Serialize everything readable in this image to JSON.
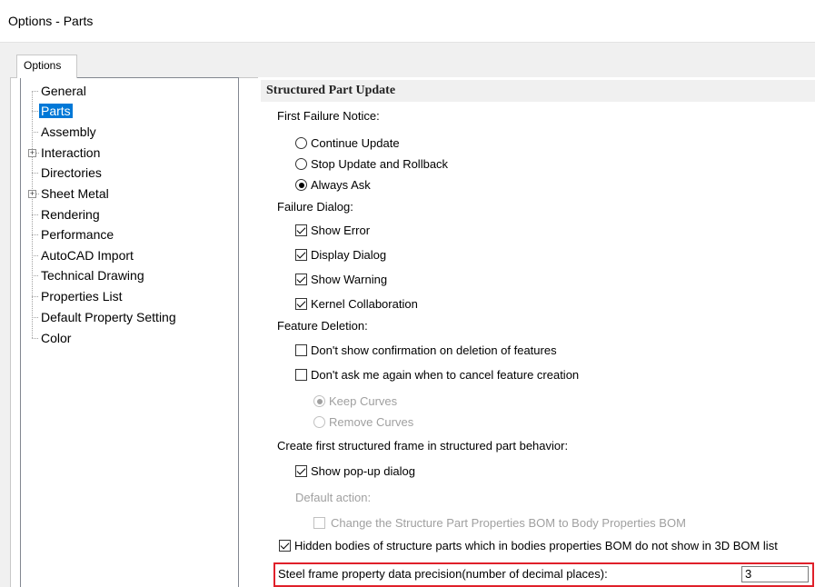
{
  "window": {
    "title": "Options - Parts"
  },
  "tabs": [
    {
      "label": "Options",
      "active": true
    }
  ],
  "tree": {
    "items": [
      {
        "label": "General",
        "selected": false,
        "expandable": false
      },
      {
        "label": "Parts",
        "selected": true,
        "expandable": false
      },
      {
        "label": "Assembly",
        "selected": false,
        "expandable": false
      },
      {
        "label": "Interaction",
        "selected": false,
        "expandable": true
      },
      {
        "label": "Directories",
        "selected": false,
        "expandable": false
      },
      {
        "label": "Sheet Metal",
        "selected": false,
        "expandable": true
      },
      {
        "label": "Rendering",
        "selected": false,
        "expandable": false
      },
      {
        "label": "Performance",
        "selected": false,
        "expandable": false
      },
      {
        "label": "AutoCAD Import",
        "selected": false,
        "expandable": false
      },
      {
        "label": "Technical Drawing",
        "selected": false,
        "expandable": false
      },
      {
        "label": "Properties List",
        "selected": false,
        "expandable": false
      },
      {
        "label": "Default Property Setting",
        "selected": false,
        "expandable": false
      },
      {
        "label": "Color",
        "selected": false,
        "expandable": false
      }
    ],
    "expander_symbol": "+"
  },
  "panel": {
    "section_title": "Structured Part Update",
    "first_failure_notice": {
      "label": "First Failure Notice:",
      "options": [
        {
          "label": "Continue Update",
          "checked": false
        },
        {
          "label": "Stop Update and Rollback",
          "checked": false
        },
        {
          "label": "Always Ask",
          "checked": true
        }
      ]
    },
    "failure_dialog": {
      "label": "Failure Dialog:",
      "options": [
        {
          "label": "Show Error",
          "checked": true
        },
        {
          "label": "Display Dialog",
          "checked": true
        },
        {
          "label": "Show Warning",
          "checked": true
        },
        {
          "label": "Kernel Collaboration",
          "checked": true
        }
      ]
    },
    "feature_deletion": {
      "label": "Feature Deletion:",
      "options": [
        {
          "label": "Don't show confirmation on deletion of features",
          "checked": false
        },
        {
          "label": "Don't ask me again when to cancel feature creation",
          "checked": false
        }
      ],
      "curve_options": [
        {
          "label": "Keep Curves",
          "checked": true,
          "enabled": false
        },
        {
          "label": "Remove Curves",
          "checked": false,
          "enabled": false
        }
      ]
    },
    "first_frame": {
      "label": "Create first structured frame in structured part behavior:",
      "show_popup": {
        "label": "Show pop-up dialog",
        "checked": true
      },
      "default_action_label": "Default action:",
      "change_bom": {
        "label": "Change the Structure Part Properties BOM to Body Properties BOM",
        "checked": false,
        "enabled": false
      }
    },
    "hidden_bodies": {
      "label": "Hidden bodies of structure parts which in bodies properties BOM do not show in 3D BOM list",
      "checked": true
    },
    "precision": {
      "label": "Steel frame property data precision(number of decimal places):",
      "value": "3"
    }
  },
  "colors": {
    "selection": "#0078d7",
    "highlight_border": "#e0202a",
    "disabled_text": "#a0a0a0"
  }
}
